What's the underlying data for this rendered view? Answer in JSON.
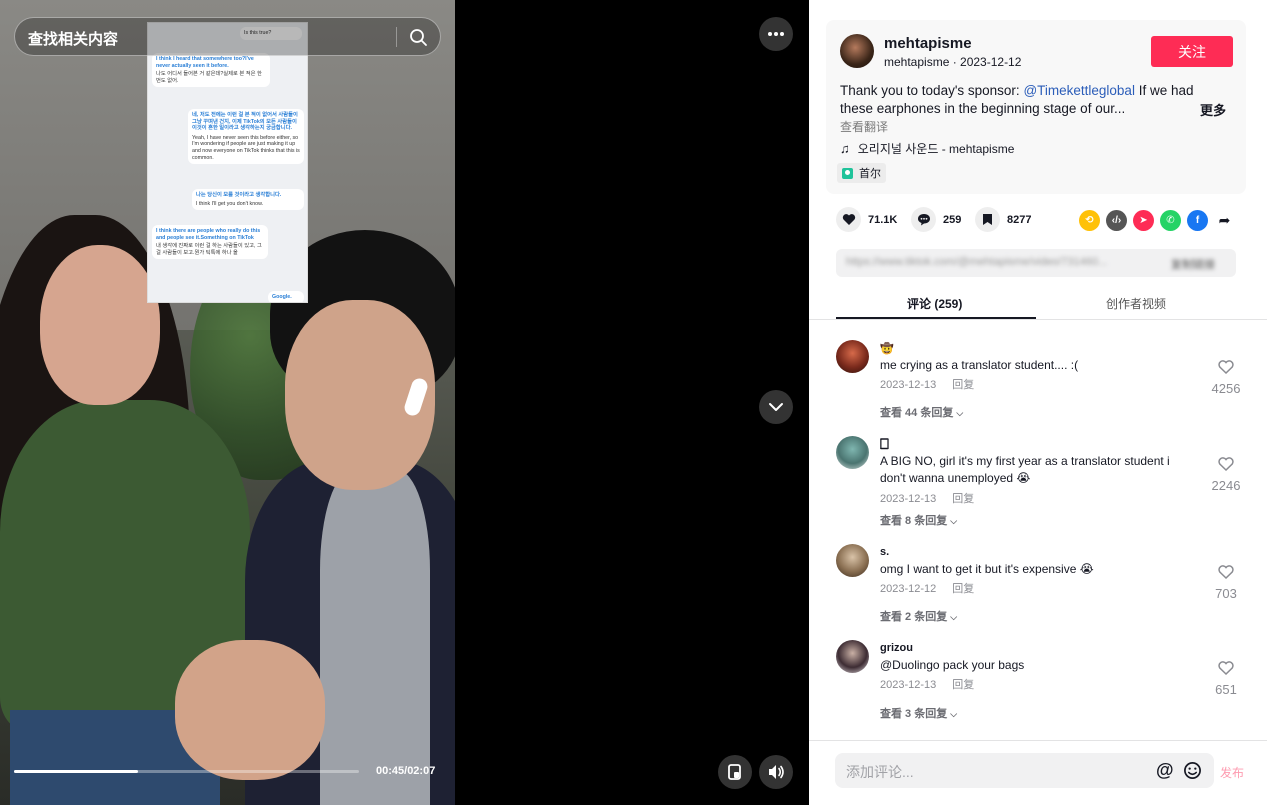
{
  "search": {
    "placeholder": "查找相关内容"
  },
  "player": {
    "time": "00:45/02:07",
    "progress": 0.36
  },
  "overlay_chat": {
    "top_snippet": "Is this true?",
    "bubble1_en": "I think I heard that somewhere too?I've never actually seen it before.",
    "bubble1_ko": "나도 어디서 들어본 거 같은데?실제로 본 적은 한 번도 없어.",
    "bubble2_ko": "네, 저도 전에는 이런 걸 본 적이 없어서 사람들이 그냥 꾸며낸 건지, 이제 TikTok의 모든 사람들이 이것이 흔한 일이라고 생각하는지 궁금합니다.",
    "bubble2_en": "Yeah, I have never seen this before either, so I'm wondering if people are just making it up and now everyone on TikTok thinks that this is common.",
    "bubble3_ko": "나는 당신이 모를 것이라고 생각합니다.",
    "bubble3_en": "I think I'll get you don't know.",
    "bubble4_en": "I think there are people who really do this and people see it.Something on TikTok",
    "bubble4_ko": "내 생각에 진짜로 이런 걸 하는 사람들이 있고, 그걸 사람들이 보고.뭔가 틱톡에 하나 올",
    "google": "Google."
  },
  "author": {
    "name": "mehtapisme",
    "meta": "mehtapisme · 2023-12-12",
    "follow_label": "关注"
  },
  "caption": {
    "prefix": "Thank you to today's sponsor: ",
    "mention": "@Timekettleglobal",
    "suffix": " If we had these earphones in the beginning stage of our...",
    "more": "更多",
    "translate": "查看翻译"
  },
  "music": {
    "title": "오리지널 사운드 - mehtapisme"
  },
  "location": {
    "label": "首尔"
  },
  "actions": {
    "likes": "71.1K",
    "comments": "259",
    "saves": "8277"
  },
  "share": {
    "link": "https://www.tiktok.com/@mehtapisme/video/731460...",
    "copy_label": "复制链接"
  },
  "tabs": {
    "comments": "评论 (259)",
    "creator_videos": "创作者视频"
  },
  "comments": [
    {
      "user": "🤠",
      "text": "me crying as a translator student.... :(",
      "date": "2023-12-13",
      "reply": "回复",
      "view_replies": "查看 44 条回复",
      "likes": "4256"
    },
    {
      "user": "🀆",
      "text": "A BIG NO, girl it's my first year as a translator student i don't wanna unemployed 😭",
      "date": "2023-12-13",
      "reply": "回复",
      "view_replies": "查看 8 条回复",
      "likes": "2246"
    },
    {
      "user": "s.",
      "text": "omg I want to get it but it's expensive 😭",
      "date": "2023-12-12",
      "reply": "回复",
      "view_replies": "查看 2 条回复",
      "likes": "703"
    },
    {
      "user": "grizou",
      "text": "@Duolingo pack your bags",
      "date": "2023-12-13",
      "reply": "回复",
      "view_replies": "查看 3 条回复",
      "likes": "651"
    }
  ],
  "comment_box": {
    "placeholder": "添加评论...",
    "mention_symbol": "@",
    "post_label": "发布"
  },
  "colors": {
    "accent": "#fe2c55",
    "mention": "#2b5db9",
    "post_disabled": "#fe9bb0"
  }
}
